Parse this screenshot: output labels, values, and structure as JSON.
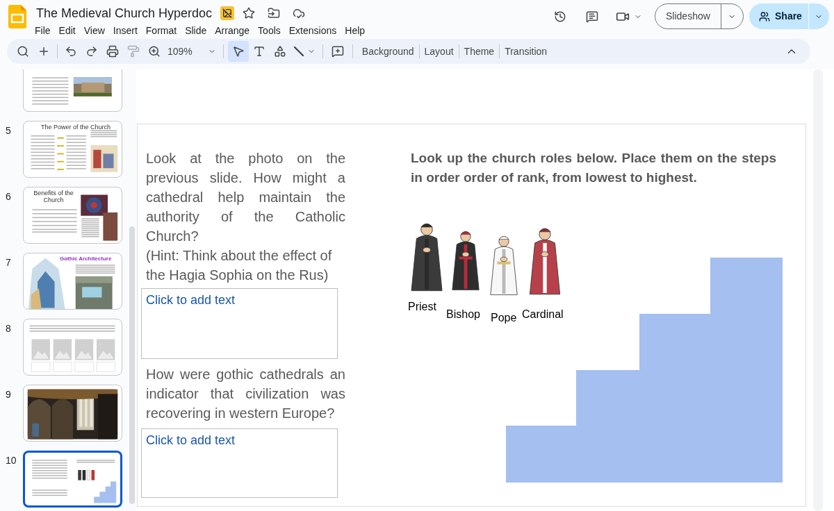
{
  "document": {
    "title": "The Medieval Church Hyperdoc"
  },
  "menu": [
    "File",
    "Edit",
    "View",
    "Insert",
    "Format",
    "Slide",
    "Arrange",
    "Tools",
    "Extensions",
    "Help"
  ],
  "header": {
    "slideshow": "Slideshow",
    "share": "Share"
  },
  "toolbar": {
    "zoom": "109%",
    "pointer_selected": true,
    "buttons": [
      "Background",
      "Layout",
      "Theme",
      "Transition"
    ]
  },
  "filmstrip": [
    {
      "kind": "text-photo",
      "selected": false
    },
    {
      "number": "5",
      "kind": "arrows",
      "title": "The Power of the Church",
      "selected": false
    },
    {
      "number": "6",
      "kind": "bullets-photo",
      "title": "Benefits of the Church",
      "selected": false
    },
    {
      "number": "7",
      "kind": "gothic",
      "title": "Gothic Architecture",
      "selected": false
    },
    {
      "number": "8",
      "kind": "placeholders",
      "selected": false
    },
    {
      "number": "9",
      "kind": "photo",
      "selected": false
    },
    {
      "number": "10",
      "kind": "current",
      "selected": true
    }
  ],
  "slide": {
    "question_1": "Look at the photo on the previous slide. How might a cathedral help maintain the authority of the Catholic Church?",
    "hint": "(Hint: Think about the effect of the Hagia Sophia on the Rus)",
    "answer_1": {
      "placeholder": "Click to add text"
    },
    "question_2": "How were gothic cathedrals an indicator that civilization was recovering in western Europe?",
    "answer_2": {
      "placeholder": "Click to add text"
    },
    "instructions": "Look up the church roles below. Place them on the steps in order order of rank, from lowest to highest.",
    "roles": [
      {
        "name": "Priest",
        "kind": "priest"
      },
      {
        "name": "Bishop",
        "kind": "bishop"
      },
      {
        "name": "Pope",
        "kind": "pope"
      },
      {
        "name": "Cardinal",
        "kind": "cardinal"
      }
    ]
  }
}
